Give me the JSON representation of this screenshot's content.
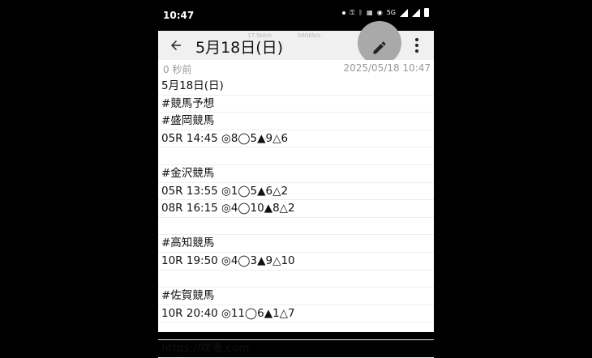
{
  "status_bar": {
    "time": "10:47",
    "network_label": "5G"
  },
  "app_bar": {
    "title": "5月18日(日)",
    "ghost_text_1": "17.9kb/s",
    "ghost_text_2": "560Kb/s"
  },
  "note": {
    "relative_time": "0 秒前",
    "timestamp": "2025/05/18 10:47",
    "lines": [
      "5月18日(日)",
      "#競馬予想",
      "#盛岡競馬",
      "05R 14:45 ◎8◯5▲9△6",
      "",
      "#金沢競馬",
      "05R 13:55 ◎1◯5▲6△2",
      "08R 16:15 ◎4◯10▲8△2",
      "",
      "#高知競馬",
      "10R 19:50 ◎4◯3▲9△10",
      "",
      "#佐賀競馬",
      "10R 20:40 ◎11◯6▲1△7",
      "",
      "https://咲庵.com"
    ]
  },
  "icons": {
    "back": "arrow-left-icon",
    "edit": "pencil-icon",
    "more": "more-vert-icon"
  }
}
